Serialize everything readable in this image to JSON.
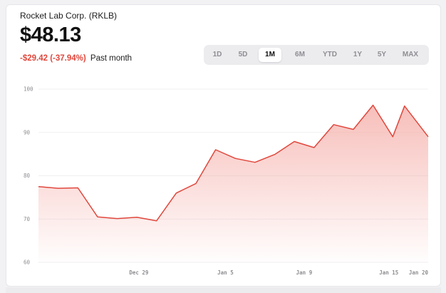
{
  "header": {
    "company": "Rocket Lab Corp. (RKLB)",
    "price": "$48.13",
    "change": "-$29.42 (-37.94%)",
    "period": "Past month"
  },
  "ranges": [
    {
      "label": "1D",
      "active": false
    },
    {
      "label": "5D",
      "active": false
    },
    {
      "label": "1M",
      "active": true
    },
    {
      "label": "6M",
      "active": false
    },
    {
      "label": "YTD",
      "active": false
    },
    {
      "label": "1Y",
      "active": false
    },
    {
      "label": "5Y",
      "active": false
    },
    {
      "label": "MAX",
      "active": false
    }
  ],
  "colors": {
    "line": "#e0473c",
    "fill": "#f4a9a3",
    "grid": "#efefef"
  },
  "chart_data": {
    "type": "area",
    "y_ticks": [
      "100",
      "90",
      "80",
      "70",
      "60"
    ],
    "ylim": [
      60,
      100
    ],
    "x_ticks": [
      {
        "label": "Dec 29",
        "x": 5.1
      },
      {
        "label": "Jan 5",
        "x": 9.5
      },
      {
        "label": "Jan 9",
        "x": 13.5
      },
      {
        "label": "Jan 15",
        "x": 17.8
      },
      {
        "label": "Jan 20",
        "x": 19.8
      }
    ],
    "xlim": [
      0,
      19.8
    ],
    "series": [
      {
        "x": [
          0,
          1,
          2,
          3,
          4,
          5,
          6,
          7,
          8,
          9,
          10,
          11,
          12,
          13,
          14,
          15,
          16,
          17,
          18,
          18.6,
          19.8
        ],
        "values": [
          77.5,
          77.1,
          77.2,
          70.5,
          70.1,
          70.4,
          69.6,
          76.0,
          78.2,
          86.0,
          84.0,
          83.1,
          84.9,
          87.9,
          86.5,
          91.8,
          90.7,
          96.3,
          89.0,
          96.1,
          89.0
        ]
      }
    ]
  }
}
